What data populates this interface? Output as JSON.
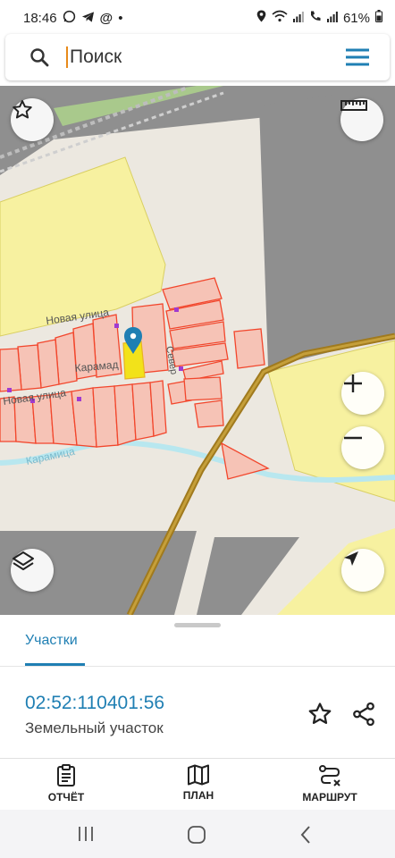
{
  "status_bar": {
    "time": "18:46",
    "at": "@",
    "dot": "•",
    "battery": "61%"
  },
  "search": {
    "placeholder": "Поиск"
  },
  "map": {
    "streets": {
      "novaya_1": "Новая улица",
      "novaya_2": "Новая улица",
      "karamad": "Карамад",
      "karamitsa": "Карамица",
      "sever": "Север"
    },
    "colors": {
      "parcel_stroke": "#f2462c",
      "parcel_fill": "#f6c3b6",
      "selected_fill": "#f2e21a",
      "zone_yellow": "#f7f1a0",
      "gray_area": "#8f8f8f",
      "road": "#a07a1e",
      "river": "#b8e7ef",
      "marker": "#1f7fb3"
    }
  },
  "panel": {
    "tab_label": "Участки",
    "cadastral_number": "02:52:110401:56",
    "parcel_type": "Земельный участок"
  },
  "bottom_nav": {
    "report": "ОТЧЁТ",
    "plan": "ПЛАН",
    "route": "МАРШРУТ"
  }
}
